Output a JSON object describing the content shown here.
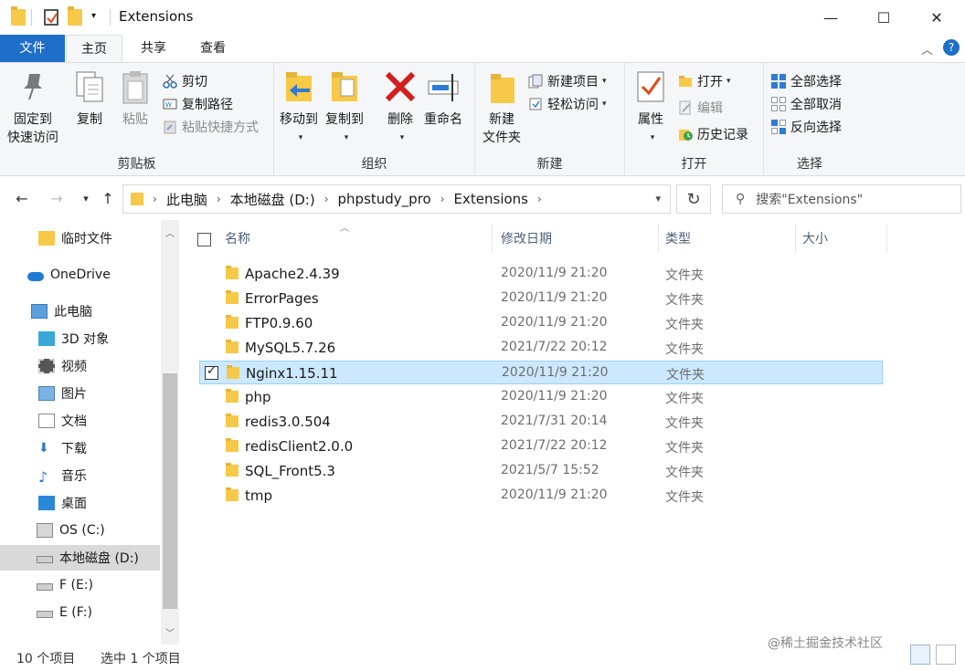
{
  "window": {
    "title": "Extensions",
    "minimize": "—",
    "maximize": "☐",
    "close": "✕"
  },
  "ribbon_tabs": {
    "file": "文件",
    "home": "主页",
    "share": "共享",
    "view": "查看"
  },
  "ribbon": {
    "clipboard": {
      "label": "剪贴板",
      "pin_line1": "固定到",
      "pin_line2": "快速访问",
      "copy": "复制",
      "paste": "粘贴",
      "cut": "剪切",
      "copy_path": "复制路径",
      "paste_shortcut": "粘贴快捷方式"
    },
    "organize": {
      "label": "组织",
      "move_to": "移动到",
      "copy_to": "复制到",
      "delete": "删除",
      "rename": "重命名"
    },
    "new": {
      "label": "新建",
      "new_folder_line1": "新建",
      "new_folder_line2": "文件夹",
      "new_item": "新建项目",
      "easy_access": "轻松访问"
    },
    "open": {
      "label": "打开",
      "properties": "属性",
      "open": "打开",
      "edit": "编辑",
      "history": "历史记录"
    },
    "select": {
      "label": "选择",
      "select_all": "全部选择",
      "select_none": "全部取消",
      "invert": "反向选择"
    }
  },
  "address": {
    "crumbs": [
      "此电脑",
      "本地磁盘 (D:)",
      "phpstudy_pro",
      "Extensions"
    ],
    "search_placeholder": "搜索\"Extensions\""
  },
  "sidebar": {
    "items": [
      {
        "label": "临时文件",
        "icon": "folder-icon"
      },
      {
        "label": "OneDrive",
        "icon": "cloud-icon"
      },
      {
        "label": "此电脑",
        "icon": "computer-icon"
      },
      {
        "label": "3D 对象",
        "icon": "cube-icon"
      },
      {
        "label": "视频",
        "icon": "video-icon"
      },
      {
        "label": "图片",
        "icon": "picture-icon"
      },
      {
        "label": "文档",
        "icon": "document-icon"
      },
      {
        "label": "下载",
        "icon": "download-icon"
      },
      {
        "label": "音乐",
        "icon": "music-icon"
      },
      {
        "label": "桌面",
        "icon": "desktop-icon"
      },
      {
        "label": "OS (C:)",
        "icon": "windows-drive-icon"
      },
      {
        "label": "本地磁盘 (D:)",
        "icon": "drive-icon"
      },
      {
        "label": "F (E:)",
        "icon": "drive-icon"
      },
      {
        "label": "E (F:)",
        "icon": "drive-icon"
      }
    ]
  },
  "columns": {
    "name": "名称",
    "modified": "修改日期",
    "type": "类型",
    "size": "大小"
  },
  "files": [
    {
      "name": "Apache2.4.39",
      "date": "2020/11/9 21:20",
      "type": "文件夹"
    },
    {
      "name": "ErrorPages",
      "date": "2020/11/9 21:20",
      "type": "文件夹"
    },
    {
      "name": "FTP0.9.60",
      "date": "2020/11/9 21:20",
      "type": "文件夹"
    },
    {
      "name": "MySQL5.7.26",
      "date": "2021/7/22 20:12",
      "type": "文件夹"
    },
    {
      "name": "Nginx1.15.11",
      "date": "2020/11/9 21:20",
      "type": "文件夹"
    },
    {
      "name": "php",
      "date": "2020/11/9 21:20",
      "type": "文件夹"
    },
    {
      "name": "redis3.0.504",
      "date": "2021/7/31 20:14",
      "type": "文件夹"
    },
    {
      "name": "redisClient2.0.0",
      "date": "2021/7/22 20:12",
      "type": "文件夹"
    },
    {
      "name": "SQL_Front5.3",
      "date": "2021/5/7 15:52",
      "type": "文件夹"
    },
    {
      "name": "tmp",
      "date": "2020/11/9 21:20",
      "type": "文件夹"
    }
  ],
  "status": {
    "count": "10 个项目",
    "selected": "选中 1 个项目"
  },
  "watermark": "@稀土掘金技术社区"
}
